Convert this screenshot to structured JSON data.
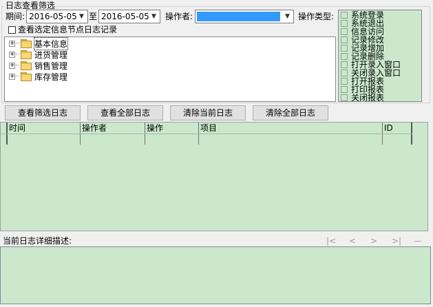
{
  "filter": {
    "group_title": "日志查看筛选",
    "period_label": "期间:",
    "date_from": "2016-05-05",
    "to_label": "至",
    "date_to": "2016-05-05",
    "operator_label": "操作者:",
    "operator_value": "",
    "optype_label": "操作类型:",
    "view_selected_label": "查看选定信息节点日志记录",
    "view_selected_checked": false
  },
  "tree": {
    "nodes": [
      {
        "label": "基本信息",
        "selected": true,
        "open": true
      },
      {
        "label": "进货管理",
        "selected": false,
        "open": false
      },
      {
        "label": "销售管理",
        "selected": false,
        "open": false
      },
      {
        "label": "库存管理",
        "selected": false,
        "open": false
      }
    ]
  },
  "op_types": [
    "系统登录",
    "系统退出",
    "信息访问",
    "记录修改",
    "记录增加",
    "记录删除",
    "打开录入窗口",
    "关闭录入窗口",
    "打开报表",
    "打印报表",
    "关闭报表"
  ],
  "buttons": {
    "view_filtered": "查看筛选日志",
    "view_all": "查看全部日志",
    "clear_current": "清除当前日志",
    "clear_all": "清除全部日志"
  },
  "grid": {
    "columns": [
      "时间",
      "操作者",
      "操作",
      "项目",
      "ID"
    ]
  },
  "detail": {
    "label": "当前日志详细描述:",
    "nav": [
      "|<",
      "<",
      ">",
      ">|",
      "—"
    ]
  },
  "colors": {
    "panel_green": "#cbe8cd",
    "selection_blue": "#3399ff"
  }
}
